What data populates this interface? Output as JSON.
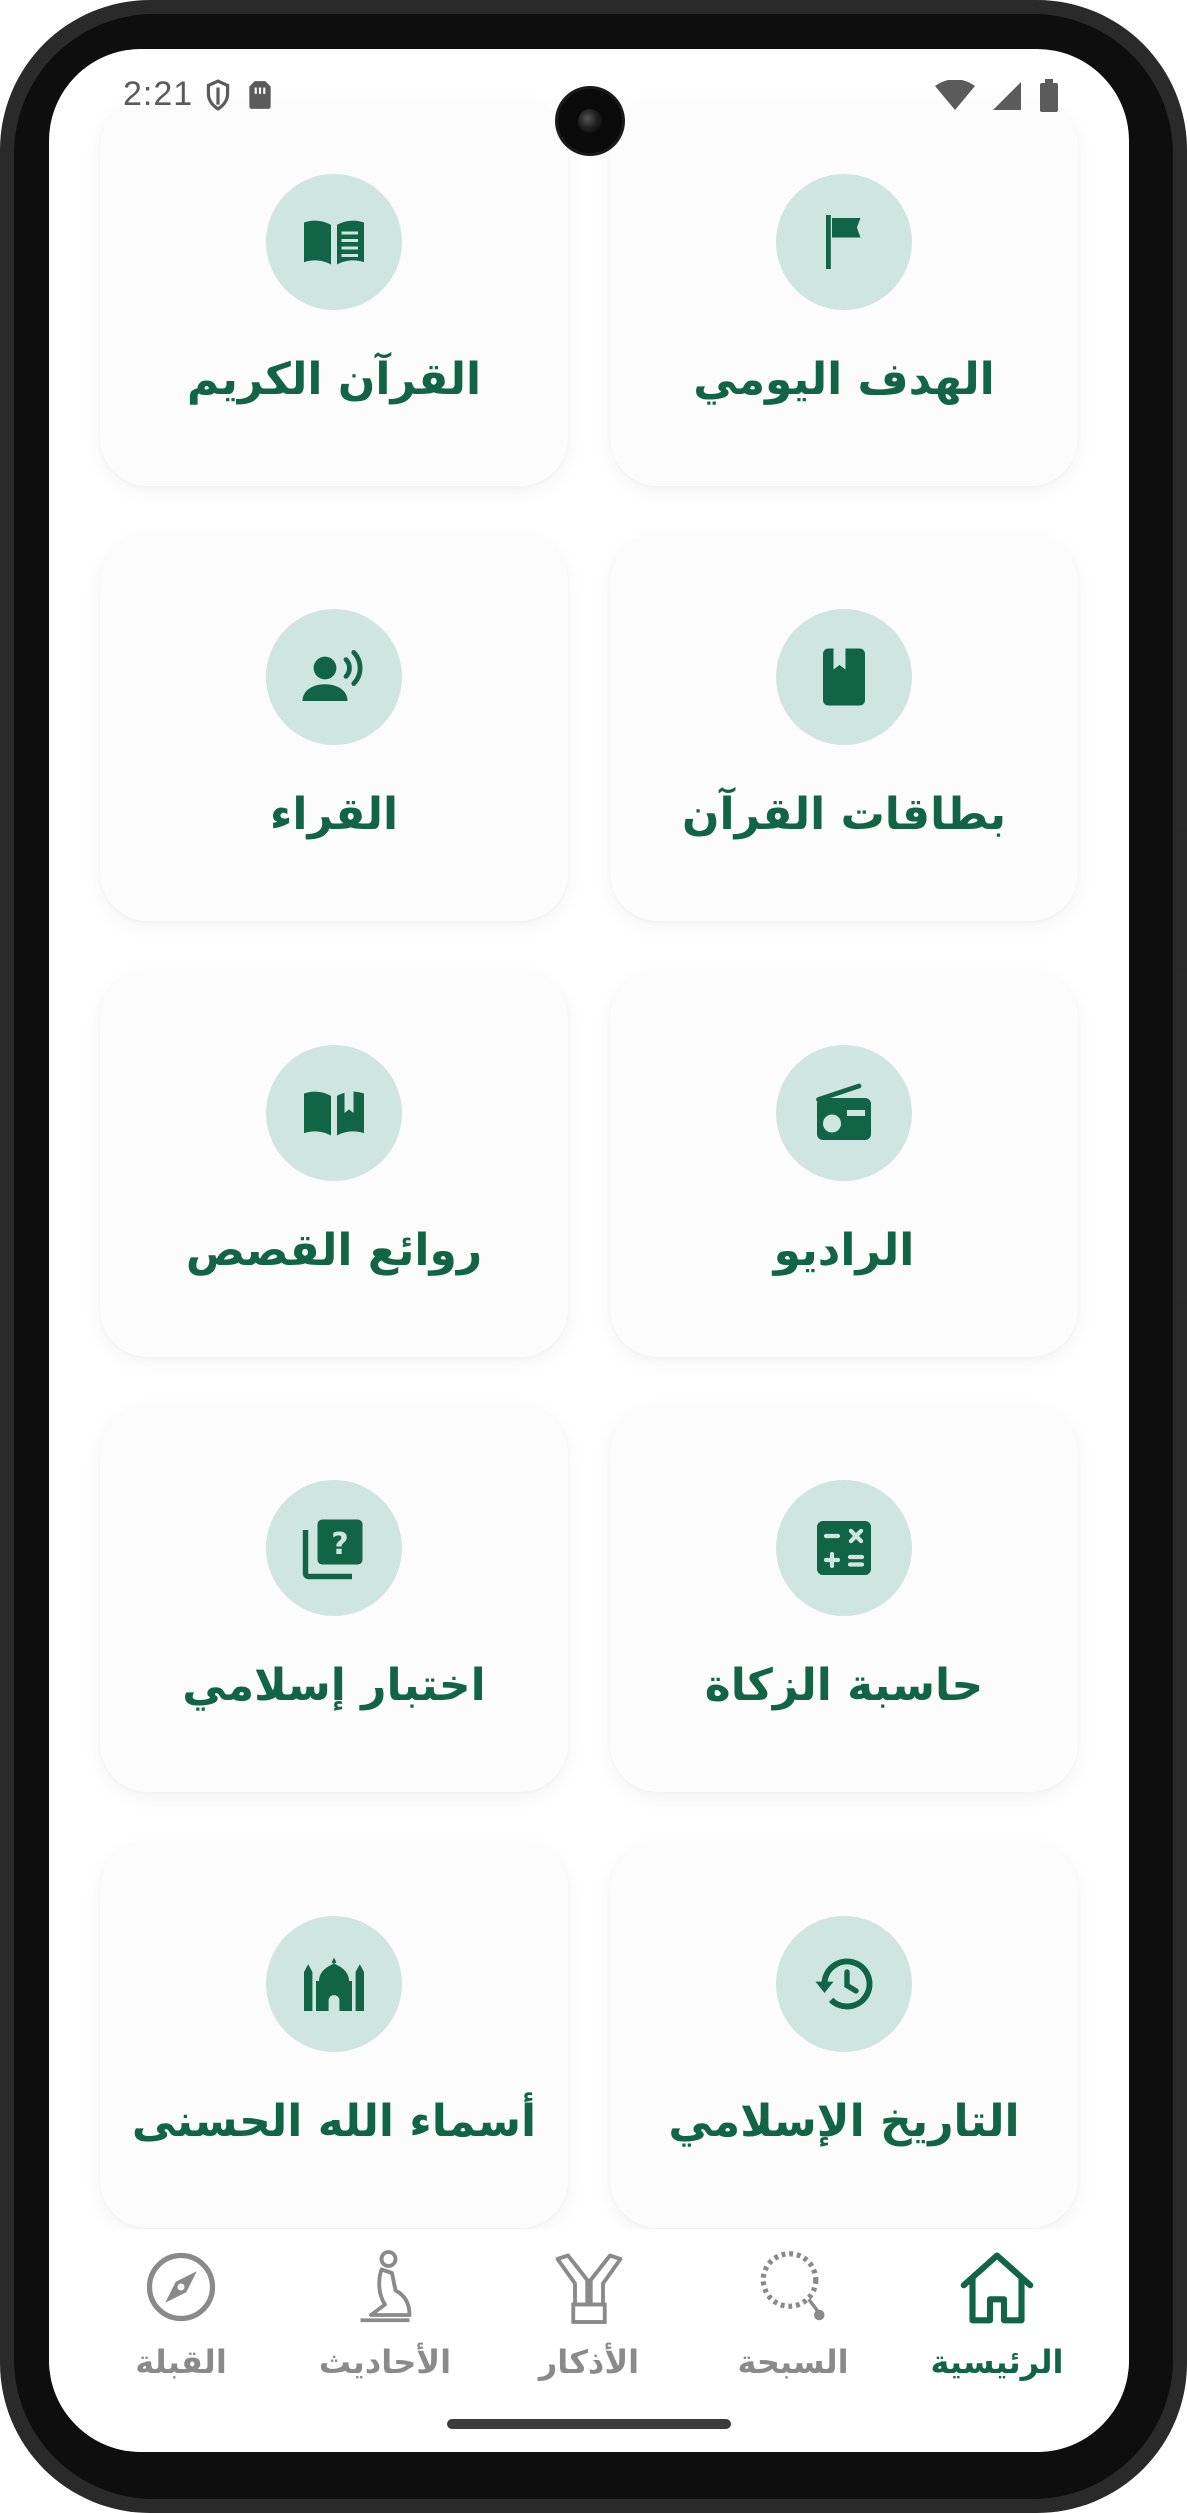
{
  "status_bar": {
    "time": "2:21",
    "left_icons": [
      "shield-icon",
      "sim-card-icon"
    ],
    "right_icons": [
      "wifi-icon",
      "cell-signal-icon",
      "battery-icon"
    ]
  },
  "grid": {
    "cards": [
      {
        "label": "الهدف اليومي",
        "icon": "flag-icon"
      },
      {
        "label": "القرآن الكريم",
        "icon": "open-book-icon"
      },
      {
        "label": "بطاقات القرآن",
        "icon": "bookmark-book-icon"
      },
      {
        "label": "القراء",
        "icon": "reciter-voice-icon"
      },
      {
        "label": "الراديو",
        "icon": "radio-icon"
      },
      {
        "label": "روائع القصص",
        "icon": "story-book-icon"
      },
      {
        "label": "حاسبة الزكاة",
        "icon": "calculator-icon"
      },
      {
        "label": "اختبار إسلامي",
        "icon": "quiz-icon"
      },
      {
        "label": "التاريخ الإسلامي",
        "icon": "history-icon"
      },
      {
        "label": "أسماء الله الحسنى",
        "icon": "mosque-icon"
      }
    ]
  },
  "bottom_nav": {
    "items": [
      {
        "label": "الرئيسية",
        "icon": "home-icon",
        "active": true
      },
      {
        "label": "السبحة",
        "icon": "prayer-beads-icon",
        "active": false
      },
      {
        "label": "الأذكار",
        "icon": "praying-hands-icon",
        "active": false
      },
      {
        "label": "الأحاديث",
        "icon": "praying-person-icon",
        "active": false
      },
      {
        "label": "القبلة",
        "icon": "compass-icon",
        "active": false
      }
    ]
  },
  "colors": {
    "accent": "#126447",
    "badge_bg": "#cfe5df",
    "card_bg": "#fcfcfc",
    "inactive": "#8a8a8a"
  }
}
